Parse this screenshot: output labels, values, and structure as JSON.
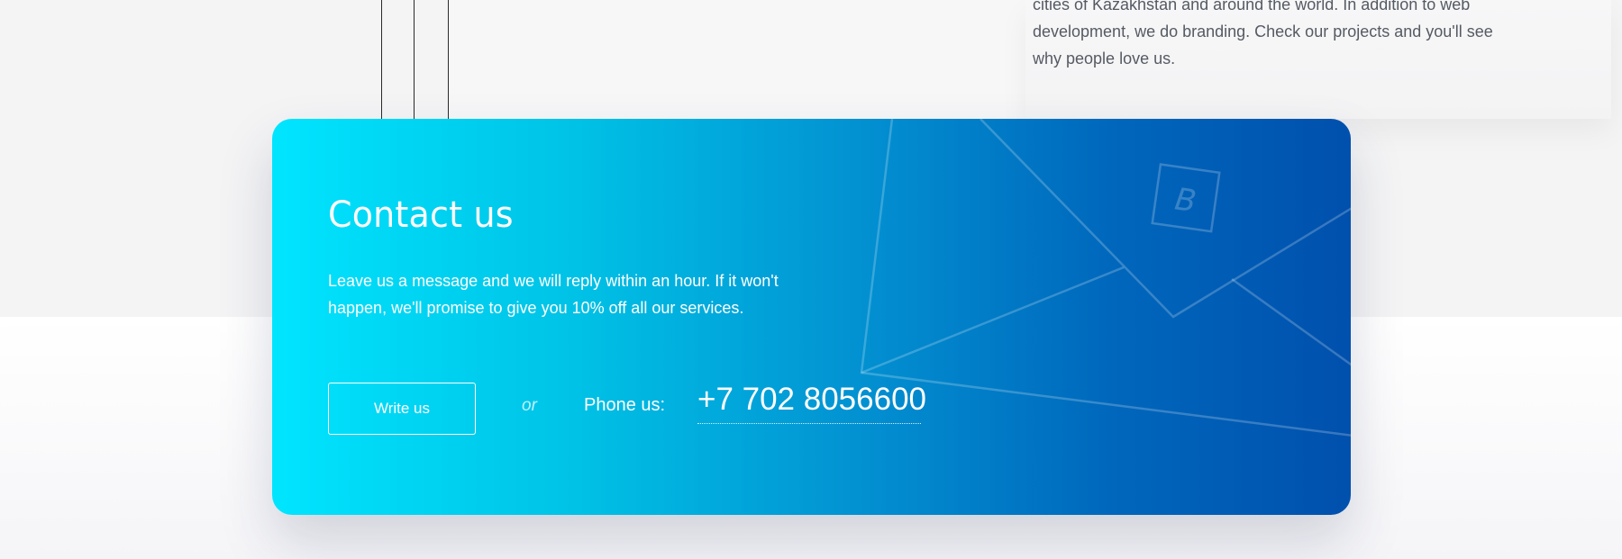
{
  "about": {
    "text": "cities of Kazakhstan and around the world. In addition to web development, we do branding. Check our projects and you'll see why people love us."
  },
  "contact": {
    "title": "Contact us",
    "description": "Leave us a message and we will reply within an hour. If it won't happen, we'll promise to give you 10% off all our services.",
    "write_button": "Write us",
    "or_label": "or",
    "phone_label": "Phone us:",
    "phone_number": "+7 702 8056600",
    "stamp_letter": "B"
  },
  "colors": {
    "gradient_start": "#00e5ff",
    "gradient_end": "#0050ad",
    "text_on_card": "#ffffff",
    "page_bg": "#f4f4f5"
  },
  "icons": {
    "envelope": "envelope-illustration"
  }
}
